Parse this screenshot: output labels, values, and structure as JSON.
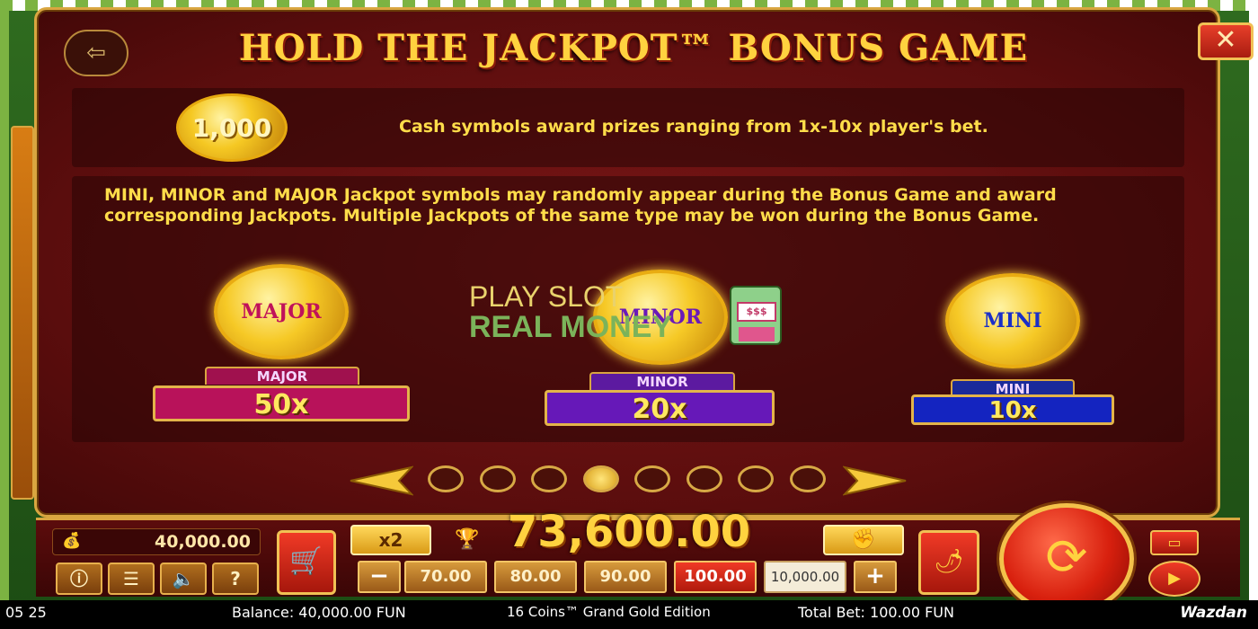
{
  "title": "HOLD THE JACKPOT™ BONUS GAME",
  "cash": {
    "coin_label": "1,000",
    "description": "Cash symbols award prizes ranging from 1x-10x player's bet."
  },
  "jackpot_description": "MINI, MINOR and MAJOR Jackpot symbols may randomly appear during the Bonus Game and award corresponding Jackpots. Multiple Jackpots of the same type may be won during the Bonus Game.",
  "jackpots": [
    {
      "coin": "MAJOR",
      "tag": "MAJOR",
      "value": "50x",
      "color": "#c0125a"
    },
    {
      "coin": "MINOR",
      "tag": "MINOR",
      "value": "20x",
      "color": "#6a1ab8"
    },
    {
      "coin": "MINI",
      "tag": "MINI",
      "value": "10x",
      "color": "#1a2fc8"
    }
  ],
  "watermark": {
    "line1": "PLAY SLOT",
    "line2": "REAL MONEY",
    "slot_text": "$$$"
  },
  "pagination": {
    "total": 8,
    "active": 4
  },
  "controls": {
    "balance": "40,000.00",
    "multiplier": "x2",
    "win": "73,600.00",
    "bets": [
      "70.00",
      "80.00",
      "90.00",
      "100.00",
      "10,000.00"
    ],
    "selected_bet": "100.00"
  },
  "status": {
    "time": "05 25",
    "balance": "Balance: 40,000.00 FUN",
    "game": "16 Coins™ Grand Gold Edition",
    "total_bet": "Total Bet: 100.00 FUN",
    "brand": "Wazdan"
  },
  "icons": [
    "exit-icon",
    "close-icon",
    "money-bag-icon",
    "info-icon",
    "menu-icon",
    "sound-icon",
    "help-icon",
    "cart-icon",
    "trophy-icon",
    "autoplay-icon",
    "turbo-icon",
    "spin-icon",
    "arrow-left-icon",
    "arrow-right-icon"
  ],
  "colors": {
    "accent": "#ffd23f",
    "panel": "#5a0d0d",
    "frame": "#d9a640"
  }
}
